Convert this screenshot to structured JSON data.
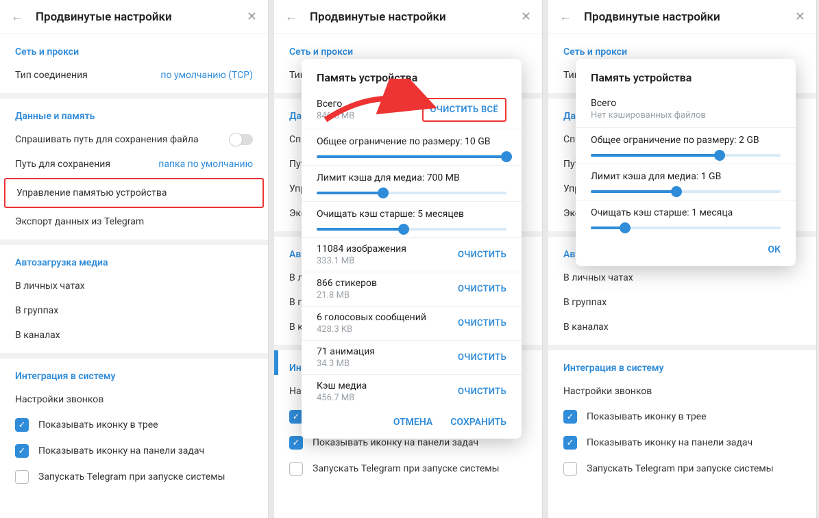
{
  "header": {
    "title": "Продвинутые настройки"
  },
  "network": {
    "title": "Сеть и прокси",
    "connection_label": "Тип соединения",
    "connection_value": "по умолчанию (TCP)"
  },
  "data": {
    "title": "Данные и память",
    "ask_path": "Спрашивать путь для сохранения файла",
    "save_path_label": "Путь для сохранения",
    "save_path_value": "папка по умолчанию",
    "manage_storage": "Управление памятью устройства",
    "export": "Экспорт данных из Telegram"
  },
  "autoload": {
    "title": "Автозагрузка медиа",
    "private": "В личных чатах",
    "groups": "В группах",
    "channels": "В каналах"
  },
  "system": {
    "title": "Интеграция в систему",
    "calls": "Настройки звонков",
    "tray": "Показывать иконку в трее",
    "taskbar": "Показывать иконку на панели задач",
    "autostart": "Запускать Telegram при запуске системы"
  },
  "dialog1": {
    "title": "Память устройства",
    "total_label": "Всего",
    "total_value": "846.5 MB",
    "clear_all": "ОЧИСТИТЬ ВСЁ",
    "limit_size": "Общее ограничение по размеру: 10 GB",
    "limit_media": "Лимит кэша для медиа: 700 MB",
    "clear_older": "Очищать кэш старше: 5 месяцев",
    "media": [
      {
        "title": "11084 изображения",
        "size": "333.1 MB",
        "action": "ОЧИСТИТЬ"
      },
      {
        "title": "866 стикеров",
        "size": "21.8 MB",
        "action": "ОЧИСТИТЬ"
      },
      {
        "title": "6 голосовых сообщений",
        "size": "428.3 KB",
        "action": "ОЧИСТИТЬ"
      },
      {
        "title": "71 анимация",
        "size": "34.3 MB",
        "action": "ОЧИСТИТЬ"
      },
      {
        "title": "Кэш медиа",
        "size": "456.7 MB",
        "action": "ОЧИСТИТЬ"
      }
    ],
    "cancel": "ОТМЕНА",
    "save": "СОХРАНИТЬ"
  },
  "dialog2": {
    "title": "Память устройства",
    "total_label": "Всего",
    "total_value": "Нет кэшированных файлов",
    "limit_size": "Общее ограничение по размеру: 2 GB",
    "limit_media": "Лимит кэша для медиа: 1 GB",
    "clear_older": "Очищать кэш старше: 1 месяца",
    "ok": "ОК"
  },
  "sliders": {
    "d1_size_pct": 100,
    "d1_media_pct": 35,
    "d1_older_pct": 46,
    "d2_size_pct": 68,
    "d2_media_pct": 45,
    "d2_older_pct": 18
  }
}
